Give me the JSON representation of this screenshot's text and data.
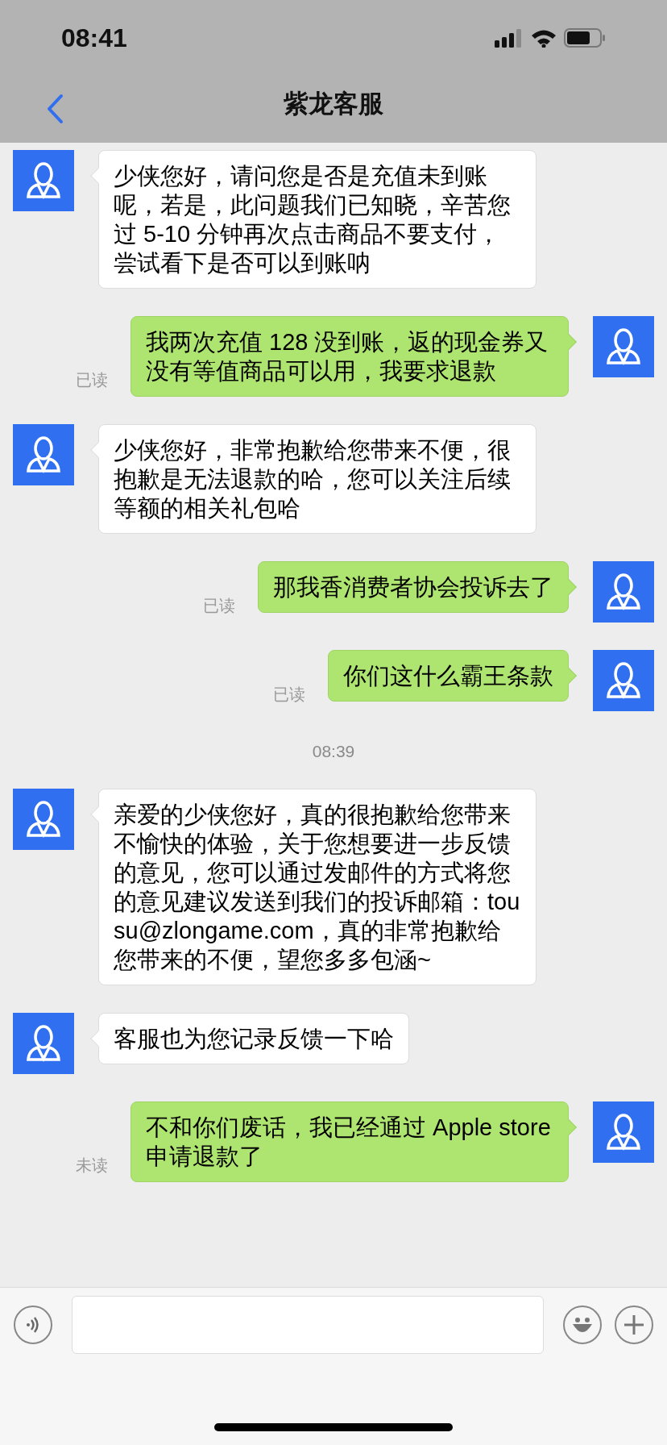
{
  "status_bar": {
    "time": "08:41"
  },
  "nav": {
    "title": "紫龙客服"
  },
  "messages": [
    {
      "kind": "received",
      "text": "少侠您好，请问您是否是充值未到账呢，若是，此问题我们已知晓，辛苦您过 5-10 分钟再次点击商品不要支付，尝试看下是否可以到账呐"
    },
    {
      "kind": "sent",
      "text": "我两次充值 128 没到账，返的现金券又没有等值商品可以用，我要求退款",
      "status": "已读"
    },
    {
      "kind": "received",
      "text": "少侠您好，非常抱歉给您带来不便，很抱歉是无法退款的哈，您可以关注后续等额的相关礼包哈"
    },
    {
      "kind": "sent",
      "text": "那我香消费者协会投诉去了",
      "status": "已读"
    },
    {
      "kind": "sent",
      "text": "你们这什么霸王条款",
      "status": "已读"
    },
    {
      "kind": "time",
      "text": "08:39"
    },
    {
      "kind": "received",
      "text": "亲爱的少侠您好，真的很抱歉给您带来不愉快的体验，关于您想要进一步反馈的意见，您可以通过发邮件的方式将您的意见建议发送到我们的投诉邮箱：tousu@zlongame.com，真的非常抱歉给您带来的不便，望您多多包涵~"
    },
    {
      "kind": "received",
      "text": "客服也为您记录反馈一下哈"
    },
    {
      "kind": "sent",
      "text": "不和你们废话，我已经通过 Apple store 申请退款了",
      "status": "未读"
    }
  ]
}
